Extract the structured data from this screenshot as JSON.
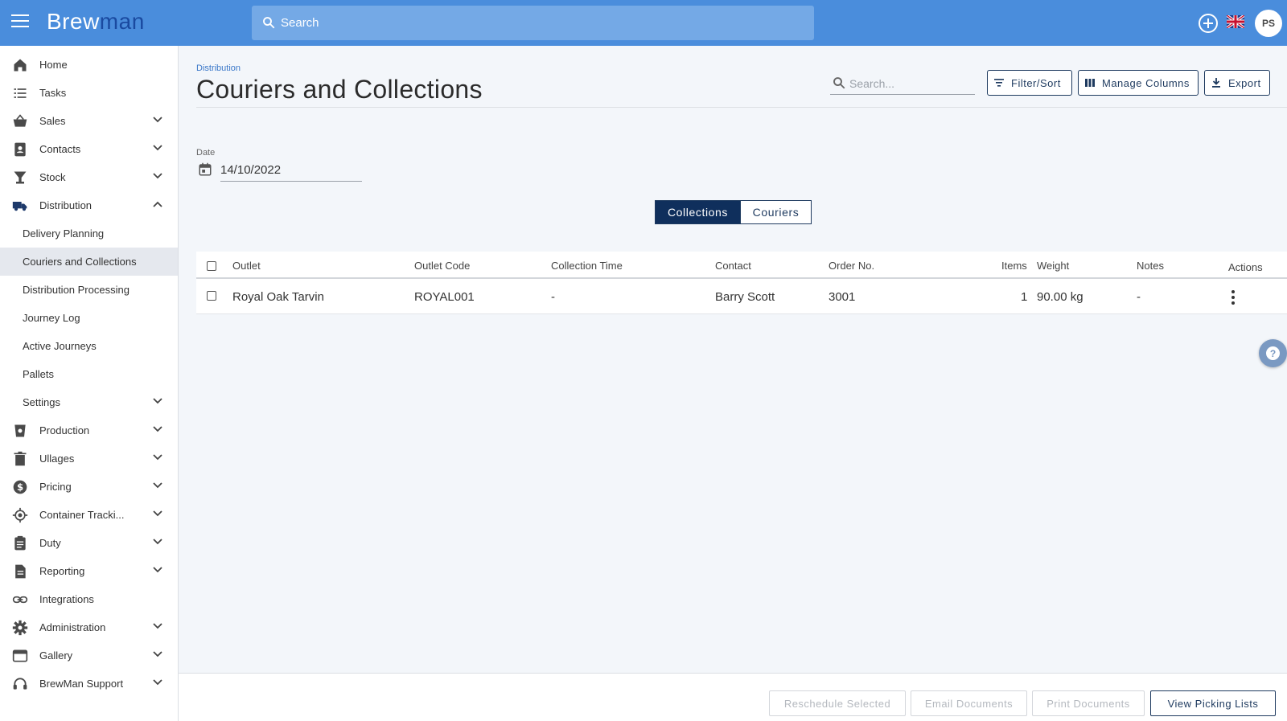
{
  "app": {
    "logo_part1": "Brew",
    "logo_part2": "man",
    "search_placeholder": "Search",
    "user_initials": "PS"
  },
  "sidebar": {
    "items": [
      {
        "label": "Home",
        "icon": "home-icon"
      },
      {
        "label": "Tasks",
        "icon": "list-icon"
      },
      {
        "label": "Sales",
        "icon": "basket-icon"
      },
      {
        "label": "Contacts",
        "icon": "contact-card-icon"
      },
      {
        "label": "Stock",
        "icon": "glass-icon"
      },
      {
        "label": "Distribution",
        "icon": "truck-icon"
      },
      {
        "label": "Production",
        "icon": "production-icon"
      },
      {
        "label": "Ullages",
        "icon": "trash-icon"
      },
      {
        "label": "Pricing",
        "icon": "dollar-icon"
      },
      {
        "label": "Container Tracki...",
        "icon": "target-icon"
      },
      {
        "label": "Duty",
        "icon": "clipboard-icon"
      },
      {
        "label": "Reporting",
        "icon": "document-icon"
      },
      {
        "label": "Integrations",
        "icon": "link-icon"
      },
      {
        "label": "Administration",
        "icon": "gear-icon"
      },
      {
        "label": "Gallery",
        "icon": "gallery-icon"
      },
      {
        "label": "BrewMan Support",
        "icon": "headset-icon"
      }
    ],
    "distribution_sub": [
      {
        "label": "Delivery Planning"
      },
      {
        "label": "Couriers and Collections"
      },
      {
        "label": "Distribution Processing"
      },
      {
        "label": "Journey Log"
      },
      {
        "label": "Active Journeys"
      },
      {
        "label": "Pallets"
      },
      {
        "label": "Settings"
      }
    ]
  },
  "page": {
    "breadcrumb": "Distribution",
    "title": "Couriers and Collections",
    "search_placeholder": "Search...",
    "buttons": {
      "filter": "Filter/Sort",
      "columns": "Manage Columns",
      "export": "Export"
    },
    "date_label": "Date",
    "date_value": "14/10/2022",
    "tabs": {
      "collections": "Collections",
      "couriers": "Couriers"
    }
  },
  "table": {
    "headers": {
      "outlet": "Outlet",
      "outlet_code": "Outlet Code",
      "collection_time": "Collection Time",
      "contact": "Contact",
      "order_no": "Order No.",
      "items": "Items",
      "weight": "Weight",
      "notes": "Notes",
      "actions": "Actions"
    },
    "rows": [
      {
        "outlet": "Royal Oak Tarvin",
        "outlet_code": "ROYAL001",
        "collection_time": "-",
        "contact": "Barry Scott",
        "order_no": "3001",
        "items": "1",
        "weight": "90.00 kg",
        "notes": "-"
      }
    ]
  },
  "footer": {
    "reschedule": "Reschedule Selected",
    "email": "Email Documents",
    "print": "Print Documents",
    "picking": "View Picking Lists"
  },
  "colors": {
    "header": "#4a8ddc",
    "primary": "#0f2f5c",
    "accent_logo": "#1a4aa0"
  }
}
